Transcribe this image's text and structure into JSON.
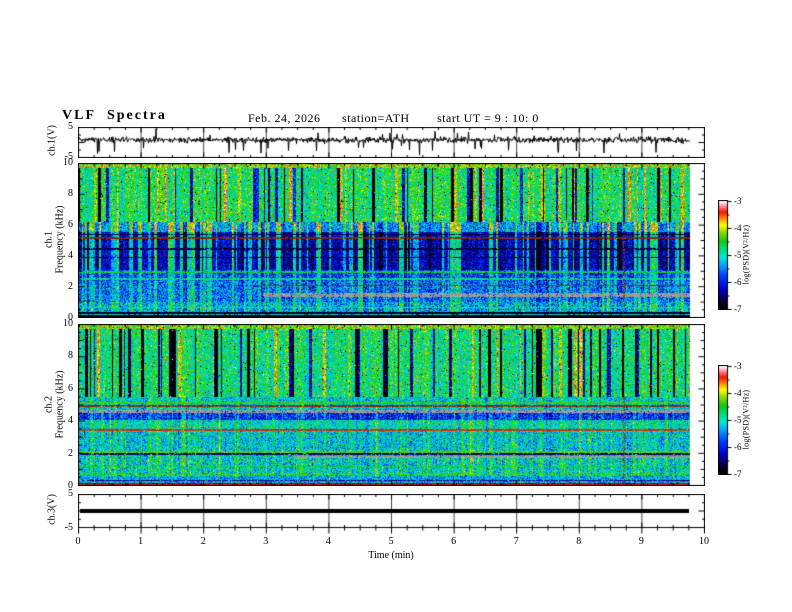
{
  "header": {
    "title": "VLF  Spectra",
    "date": "Feb. 24, 2026",
    "station": "station=ATH",
    "start_ut": "start UT =  9 : 10: 0"
  },
  "axes": {
    "x_title": "Time  (min)",
    "x_ticks": [
      "0",
      "1",
      "2",
      "3",
      "4",
      "5",
      "6",
      "7",
      "8",
      "9",
      "10"
    ],
    "freq_ticks": [
      "10",
      "8",
      "6",
      "4",
      "2",
      "0"
    ],
    "volt_ticks": [
      "5",
      "-5"
    ],
    "cbar_ticks": [
      "-3",
      "-4",
      "-5",
      "-6",
      "-7"
    ],
    "y_label_ch1": "ch.1(V)",
    "y_label_spec1_line1": "ch.1",
    "y_label_spec1_line2": "Frequency  (kHz)",
    "y_label_spec2_line1": "ch.2",
    "y_label_spec2_line2": "Frequency  (kHz)",
    "y_label_ch3": "ch.3(V)",
    "cbar_label": "log(PSD)(V²/Hz)"
  },
  "chart_data": [
    {
      "type": "line",
      "name": "ch1_voltage_waveform",
      "ylabel": "ch.1(V)",
      "ylim": [
        -5,
        5
      ],
      "xlim": [
        0,
        10
      ],
      "description": "Noisy broadband voltage trace near +1 V with impulsive spikes reaching -5 and +5 V",
      "gen": {
        "seed": 41,
        "baseline": 0.9,
        "sigma": 0.5,
        "p_spike_down": 0.022,
        "spike_down": [
          1.5,
          3.5
        ],
        "p_spike_up": 0.012,
        "spike_up": [
          1.2,
          2.8
        ]
      }
    },
    {
      "type": "heatmap",
      "name": "ch1_spectrogram",
      "ylabel": "ch.1 Frequency (kHz)",
      "ylim": [
        0,
        10
      ],
      "xlim": [
        0,
        10
      ],
      "colorbar": {
        "label": "log(PSD)(V²/Hz)",
        "range": [
          -7,
          -3
        ]
      },
      "gen": {
        "seed": 7,
        "fmax": 10,
        "streaks": {
          "top": {
            "p_dark": 0.13,
            "dark": [
              1.2,
              1.6
            ],
            "p_bright": 0.1,
            "bright": [
              0.5,
              0.7
            ],
            "jitter": 0.5
          },
          "mid": {
            "p_dark": 0.06,
            "dark": [
              0.4,
              0.4
            ],
            "p_bright": 0.28,
            "bright": [
              0.9,
              0.9
            ],
            "jitter": 0.4
          }
        },
        "bands": [
          {
            "f0": 9.75,
            "f1": 10.0,
            "base": -4.15,
            "sigma": 0.55,
            "streak": "none",
            "salt": true
          },
          {
            "f0": 6.2,
            "f1": 9.75,
            "base": -4.7,
            "sigma": 0.4,
            "streak": "top",
            "salt": true
          },
          {
            "f0": 5.55,
            "f1": 6.2,
            "base": -5.4,
            "sigma": 0.45,
            "streak": "mid"
          },
          {
            "f0": 3.1,
            "f1": 5.55,
            "base": -6.3,
            "sigma": 0.35,
            "streak": "mid"
          },
          {
            "f0": 2.35,
            "f1": 3.1,
            "base": -5.85,
            "sigma": 0.45,
            "streak": "midweak"
          },
          {
            "f0": 1.0,
            "f1": 2.35,
            "base": -5.65,
            "sigma": 0.5,
            "streak": "midweak"
          },
          {
            "f0": 0.35,
            "f1": 1.0,
            "base": -5.35,
            "sigma": 0.55,
            "streak": "midweak"
          },
          {
            "f0": 0.0,
            "f1": 0.35,
            "base": -6.85,
            "sigma": 0.3,
            "streak": "none"
          }
        ],
        "hlines": [
          {
            "f": 5.15,
            "df": 0.05,
            "type": "color",
            "rgb": [
              130,
              40,
              10
            ]
          },
          {
            "f": 5.38,
            "df": 0.04,
            "type": "value",
            "v": -6.7
          },
          {
            "f": 4.45,
            "df": 0.04,
            "type": "value",
            "v": -6.7
          },
          {
            "f": 3.9,
            "df": 0.04,
            "type": "value",
            "v": -6.65
          },
          {
            "f": 2.95,
            "df": 0.06,
            "type": "value",
            "v": -4.55
          },
          {
            "f": 2.5,
            "df": 0.05,
            "type": "value",
            "v": -4.8
          },
          {
            "f": 2.06,
            "df": 0.05,
            "type": "color",
            "rgb": [
              150,
              50,
              10
            ],
            "t0": 0.28
          },
          {
            "f": 1.45,
            "df": 0.13,
            "type": "gray",
            "t0": 0.3
          },
          {
            "f": 0.62,
            "df": 0.05,
            "type": "value",
            "v": -4.9
          },
          {
            "f": 0.18,
            "df": 0.04,
            "type": "value",
            "v": -5.1
          },
          {
            "f": 0.05,
            "df": 0.04,
            "type": "value",
            "v": -6.9
          }
        ],
        "vlines": [
          {
            "t": 8.72,
            "f0": 0,
            "f1": 6.2,
            "rgb": [
              140,
              60,
              10
            ],
            "p": 0.45
          }
        ]
      }
    },
    {
      "type": "heatmap",
      "name": "ch2_spectrogram",
      "ylabel": "ch.2 Frequency (kHz)",
      "ylim": [
        0,
        10
      ],
      "xlim": [
        0,
        10
      ],
      "colorbar": {
        "label": "log(PSD)(V²/Hz)",
        "range": [
          -7,
          -3
        ]
      },
      "gen": {
        "seed": 19,
        "fmax": 10,
        "streaks": {
          "top": {
            "p_dark": 0.2,
            "dark": [
              1.4,
              1.6
            ],
            "p_bright": 0.08,
            "bright": [
              0.4,
              0.6
            ],
            "jitter": 0.5
          },
          "mid": {
            "p_dark": 0.06,
            "dark": [
              0.4,
              0.4
            ],
            "p_bright": 0.22,
            "bright": [
              0.6,
              0.7
            ],
            "jitter": 0.4
          }
        },
        "bands": [
          {
            "f0": 9.75,
            "f1": 10.0,
            "base": -4.2,
            "sigma": 0.55,
            "streak": "none",
            "salt": true
          },
          {
            "f0": 5.5,
            "f1": 9.75,
            "base": -4.75,
            "sigma": 0.4,
            "streak": "top",
            "salt": true
          },
          {
            "f0": 4.7,
            "f1": 5.5,
            "base": -5.15,
            "sigma": 0.45,
            "streak": "midweak"
          },
          {
            "f0": 4.05,
            "f1": 4.7,
            "base": -5.95,
            "sigma": 0.45,
            "streak": "midweak",
            "vq": true
          },
          {
            "f0": 3.3,
            "f1": 4.05,
            "base": -5.05,
            "sigma": 0.4,
            "streak": "midweak",
            "vq": true
          },
          {
            "f0": 2.2,
            "f1": 3.3,
            "base": -5.2,
            "sigma": 0.45,
            "streak": "midweak",
            "vq": true
          },
          {
            "f0": 0.55,
            "f1": 2.2,
            "base": -5.1,
            "sigma": 0.5,
            "streak": "midweak",
            "vq": true
          },
          {
            "f0": 0.12,
            "f1": 0.55,
            "base": -5.35,
            "sigma": 0.45,
            "streak": "none",
            "vq": true
          },
          {
            "f0": 0.0,
            "f1": 0.12,
            "base": -6.9,
            "sigma": 0.2,
            "streak": "none"
          }
        ],
        "hlines": [
          {
            "f": 5.15,
            "df": 0.06,
            "type": "value",
            "v": -4.4
          },
          {
            "f": 4.95,
            "df": 0.05,
            "type": "color",
            "rgb": [
              130,
              40,
              10
            ]
          },
          {
            "f": 4.6,
            "df": 0.1,
            "type": "gray"
          },
          {
            "f": 3.45,
            "df": 0.06,
            "type": "color",
            "rgb": [
              210,
              40,
              0
            ]
          },
          {
            "f": 3.1,
            "df": 0.04,
            "type": "value",
            "v": -4.5
          },
          {
            "f": 2.08,
            "df": 0.07,
            "type": "value",
            "v": -4.3
          },
          {
            "f": 1.93,
            "df": 0.05,
            "type": "value",
            "v": -6.6
          },
          {
            "f": 1.75,
            "df": 0.09,
            "type": "gray",
            "t0": 0.35
          },
          {
            "f": 1.15,
            "df": 0.04,
            "type": "value",
            "v": -4.6
          },
          {
            "f": 0.65,
            "df": 0.05,
            "type": "value",
            "v": -4.35
          },
          {
            "f": 0.3,
            "df": 0.04,
            "type": "value",
            "v": -6.5
          },
          {
            "f": 0.07,
            "df": 0.05,
            "type": "color",
            "rgb": [
              200,
              20,
              10
            ]
          }
        ],
        "vlines": [
          {
            "t": 8.72,
            "f0": 0,
            "f1": 5.5,
            "rgb": [
              140,
              60,
              10
            ],
            "p": 0.5
          }
        ]
      }
    },
    {
      "type": "line",
      "name": "ch3_voltage_waveform",
      "ylabel": "ch.3(V)",
      "ylim": [
        -5,
        5
      ],
      "xlim": [
        0,
        10
      ],
      "constant_value": 0,
      "description": "Flat thick trace at 0 V (dead channel)"
    }
  ],
  "colormap": {
    "range": [
      -7,
      -3
    ],
    "stops": [
      [
        0.0,
        "#000000"
      ],
      [
        0.08,
        "#0a003c"
      ],
      [
        0.18,
        "#0000c8"
      ],
      [
        0.3,
        "#003cff"
      ],
      [
        0.4,
        "#00a0ff"
      ],
      [
        0.48,
        "#00e6d2"
      ],
      [
        0.56,
        "#00dc78"
      ],
      [
        0.63,
        "#14c814"
      ],
      [
        0.72,
        "#96dc00"
      ],
      [
        0.78,
        "#ffff00"
      ],
      [
        0.84,
        "#ff8c00"
      ],
      [
        0.9,
        "#ff1400"
      ],
      [
        0.96,
        "#ff96aa"
      ],
      [
        1.0,
        "#ffffff"
      ]
    ]
  }
}
